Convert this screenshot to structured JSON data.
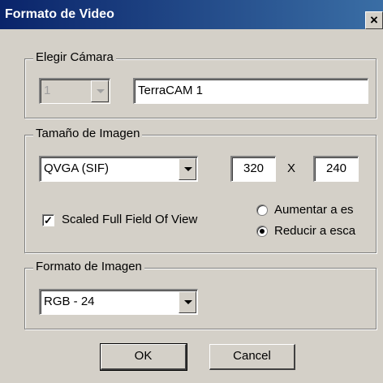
{
  "window": {
    "title": "Formato de Video",
    "close_glyph": "×"
  },
  "camera_group": {
    "legend": "Elegir Cámara",
    "camera_index": "1",
    "camera_name": "TerraCAM 1"
  },
  "image_size_group": {
    "legend": "Tamaño de Imagen",
    "format": "QVGA (SIF)",
    "width": "320",
    "separator": "X",
    "height": "240",
    "scaled_label": "Scaled Full Field Of View",
    "scaled_checked": "✓",
    "radio_1_label": "Aumentar a es",
    "radio_2_label": "Reducir a esca"
  },
  "image_format_group": {
    "legend": "Formato de Imagen",
    "format": "RGB  - 24"
  },
  "buttons": {
    "ok": "OK",
    "cancel": "Cancel"
  },
  "colors": {
    "title_bar_start": "#0a246a",
    "title_bar_end": "#3a6ea5",
    "dialog_bg": "#d4d0c8"
  },
  "icons": [
    "close-icon",
    "dropdown-arrow-icon",
    "check-icon",
    "radio-dot-icon"
  ]
}
